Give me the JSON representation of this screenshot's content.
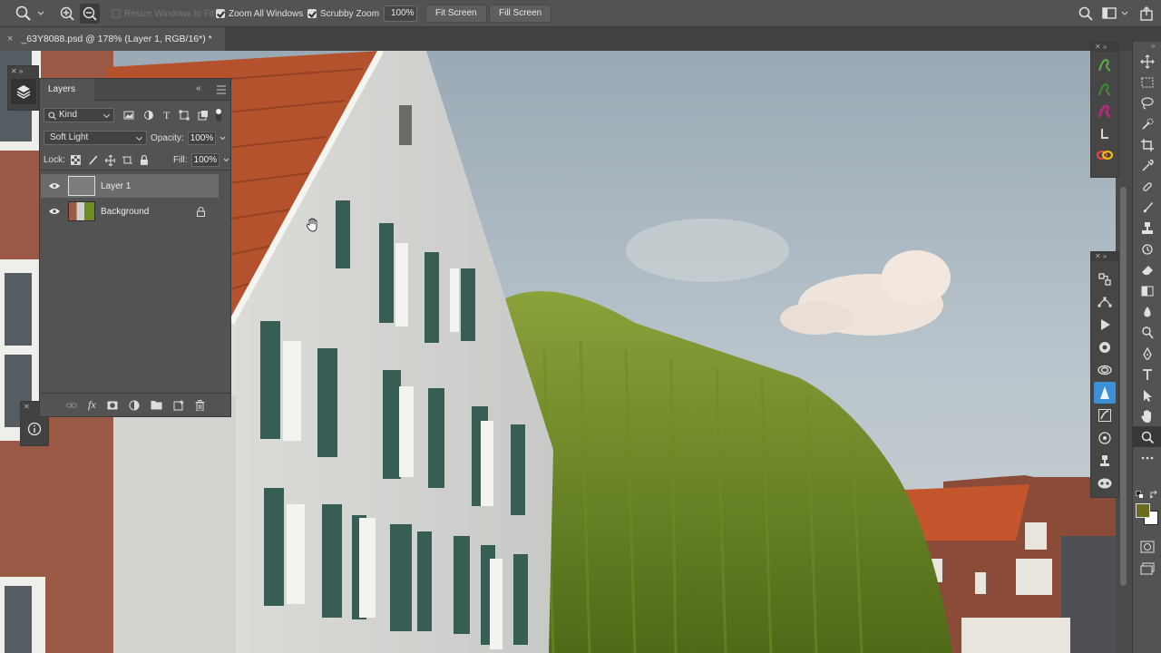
{
  "options_bar": {
    "resize_windows_label": "Resize Windows to Fit",
    "zoom_all_label": "Zoom All Windows",
    "scrubby_label": "Scrubby Zoom",
    "zoom_value": "100%",
    "fit_screen_label": "Fit Screen",
    "fill_screen_label": "Fill Screen",
    "resize_windows_checked": false,
    "zoom_all_checked": true,
    "scrubby_checked": true
  },
  "document_tab": {
    "close_glyph": "×",
    "title": "_63Y8088.psd @ 178% (Layer 1, RGB/16*) *"
  },
  "layers_panel": {
    "tab_label": "Layers",
    "filter_kind": "Kind",
    "blend_mode": "Soft Light",
    "opacity_label": "Opacity:",
    "opacity_value": "100%",
    "lock_label": "Lock:",
    "fill_label": "Fill:",
    "fill_value": "100%",
    "layers": [
      {
        "name": "Layer 1",
        "visible": true,
        "active": true,
        "locked": false
      },
      {
        "name": "Background",
        "visible": true,
        "active": false,
        "locked": true
      }
    ],
    "footer_fx": "fx"
  },
  "colors": {
    "foreground": "#6b6a1e",
    "background": "#ffffff",
    "accent_tool": "#4aa3ff"
  },
  "tools": [
    "move-icon",
    "marquee-icon",
    "lasso-icon",
    "quick-select-icon",
    "crop-icon",
    "eyedropper-icon",
    "healing-brush-icon",
    "brush-icon",
    "clone-stamp-icon",
    "history-brush-icon",
    "eraser-icon",
    "gradient-icon",
    "blur-icon",
    "dodge-icon",
    "pen-icon",
    "type-icon",
    "path-select-icon",
    "hand-icon",
    "zoom-icon",
    "more-tools-icon"
  ]
}
